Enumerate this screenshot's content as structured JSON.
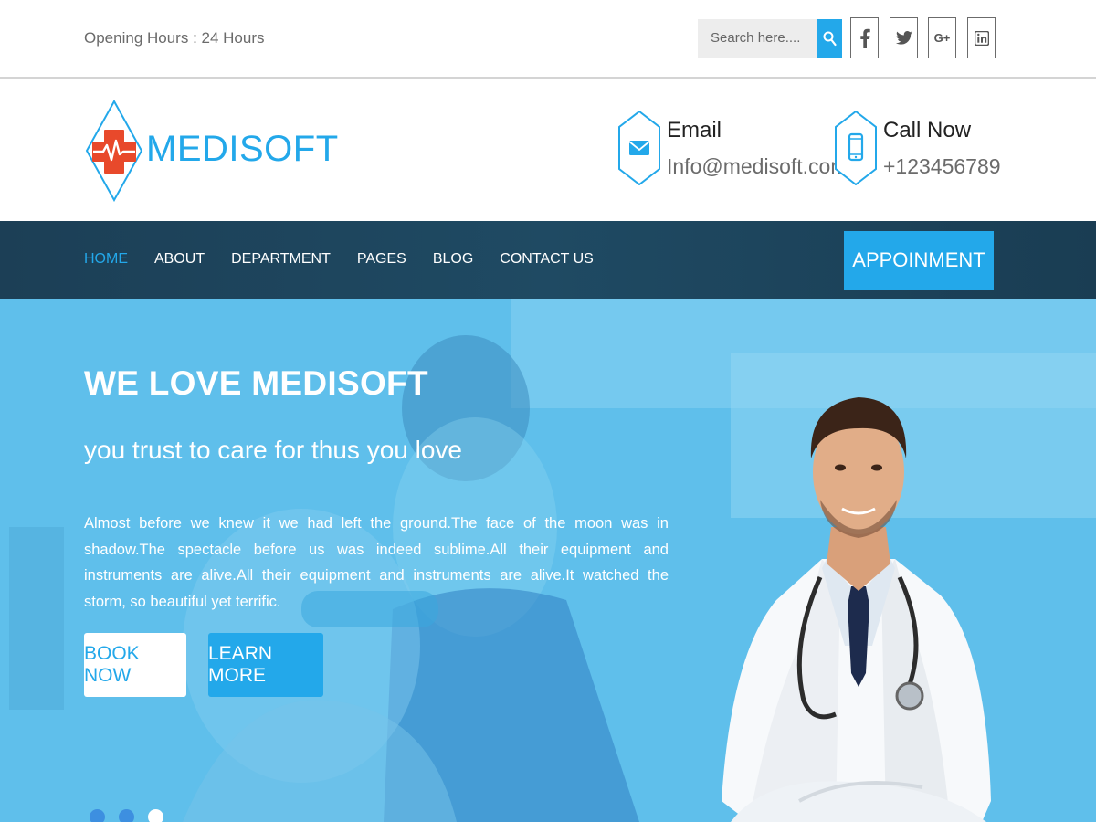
{
  "topbar": {
    "opening_hours": "Opening Hours : 24 Hours",
    "search_placeholder": "Search here....",
    "social": [
      {
        "name": "facebook-icon",
        "glyph": "f"
      },
      {
        "name": "twitter-icon",
        "glyph": "t"
      },
      {
        "name": "google-plus-icon",
        "glyph": "G+"
      },
      {
        "name": "linkedin-icon",
        "glyph": "in"
      }
    ]
  },
  "header": {
    "logo_text": "MEDISOFT",
    "email": {
      "title": "Email",
      "value": "Info@medisoft.com",
      "icon": "envelope-icon"
    },
    "phone": {
      "title": "Call Now",
      "value": "+123456789",
      "icon": "mobile-phone-icon"
    }
  },
  "nav": {
    "items": [
      {
        "label": "HOME",
        "active": true
      },
      {
        "label": "ABOUT",
        "active": false
      },
      {
        "label": "DEPARTMENT",
        "active": false
      },
      {
        "label": "PAGES",
        "active": false
      },
      {
        "label": "BLOG",
        "active": false
      },
      {
        "label": "CONTACT US",
        "active": false
      }
    ],
    "appointment_label": "APPOINMENT"
  },
  "hero": {
    "title": "WE LOVE MEDISOFT",
    "subtitle": "you trust to care for thus you love",
    "text": "Almost before we knew it we had left the ground.The face of the moon was in shadow.The spectacle before us was indeed sublime.All their equipment and instruments are alive.All their equipment and instruments are alive.It watched the storm, so beautiful yet terrific.",
    "book_label": "BOOK NOW",
    "learn_label": "LEARN MORE",
    "slides_total": 3,
    "active_slide": 3
  },
  "colors": {
    "accent": "#23a8ea",
    "nav_bg": "#1f4a63",
    "logo_cross": "#e8492b",
    "hero_overlay": "#5cbde9"
  }
}
